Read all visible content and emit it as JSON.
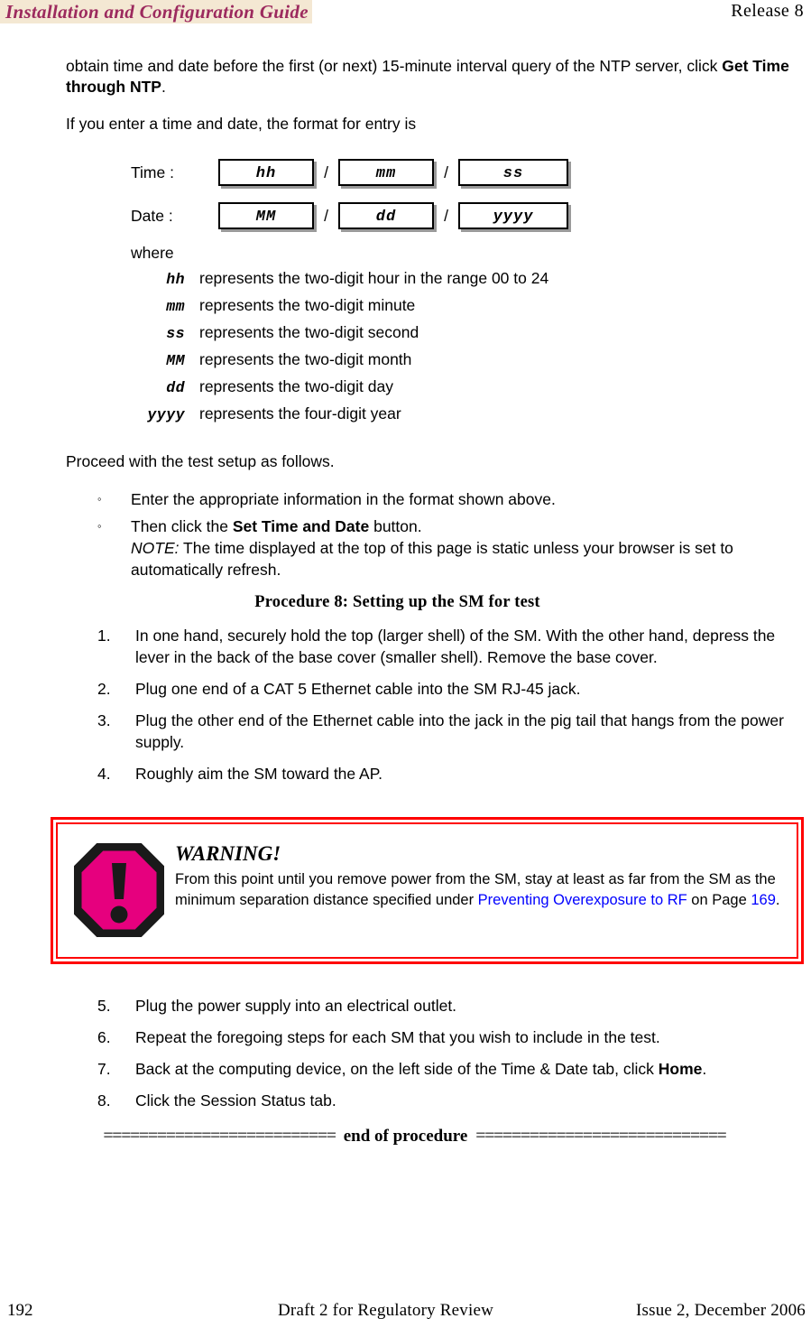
{
  "header": {
    "title": "Installation and Configuration Guide",
    "release": "Release 8",
    "highlight_color": "#f4e8d3",
    "title_color": "#9c2a5e"
  },
  "intro": {
    "para1_before": "obtain time and date before the first (or next) 15-minute interval query of the NTP server, click ",
    "para1_bold": "Get Time through NTP",
    "para1_after": ".",
    "para2": "If you enter a time and date, the format for entry is"
  },
  "entry_form": {
    "time_label": "Time :",
    "date_label": "Date :",
    "separator": "/",
    "time_fields": [
      "hh",
      "mm",
      "ss"
    ],
    "date_fields": [
      "MM",
      "dd",
      "yyyy"
    ]
  },
  "where": {
    "label": "where",
    "definitions": [
      {
        "term": "hh",
        "desc": "represents the two-digit hour in the range 00 to 24"
      },
      {
        "term": "mm",
        "desc": "represents the two-digit minute"
      },
      {
        "term": "ss",
        "desc": "represents the two-digit second"
      },
      {
        "term": "MM",
        "desc": "represents the two-digit month"
      },
      {
        "term": "dd",
        "desc": "represents the two-digit day"
      },
      {
        "term": "yyyy",
        "desc": "represents the four-digit year"
      }
    ]
  },
  "proceed": {
    "lead_in": "Proceed with the test setup as follows.",
    "bullet_mark": "◦",
    "bullets": {
      "b1": "Enter the appropriate information in the format shown above.",
      "b2_before": "Then click the ",
      "b2_bold": "Set Time and Date",
      "b2_after": " button.",
      "b2_note_label": "NOTE:",
      "b2_note_text": " The time displayed at the top of this page is static unless your browser is set to automatically refresh."
    }
  },
  "procedure": {
    "caption": "Procedure 8: Setting up the SM for test",
    "steps_first": [
      {
        "num": "1.",
        "text": "In one hand, securely hold the top (larger shell) of the SM. With the other hand, depress the lever in the back of the base cover (smaller shell). Remove the base cover."
      },
      {
        "num": "2.",
        "text": "Plug one end of a CAT 5 Ethernet cable into the SM RJ-45 jack."
      },
      {
        "num": "3.",
        "text": "Plug the other end of the Ethernet cable into the jack in the pig tail that hangs from the power supply."
      },
      {
        "num": "4.",
        "text": "Roughly aim the SM toward the AP."
      }
    ],
    "step5": {
      "num": "5.",
      "text": "Plug the power supply into an electrical outlet."
    },
    "step6": {
      "num": "6.",
      "text": "Repeat the foregoing steps for each SM that you wish to include in the test."
    },
    "step7": {
      "num": "7.",
      "text_before": "Back at the computing device, on the left side of the Time & Date tab, click ",
      "text_bold": "Home",
      "text_after": "."
    },
    "step8": {
      "num": "8.",
      "text": "Click the Session Status tab."
    }
  },
  "warning": {
    "title": "WARNING!",
    "text_before": "From this point until you remove power from the SM, stay at least as far from the SM as the minimum separation distance specified under ",
    "xref_title": "Preventing Overexposure to RF",
    "text_middle": "  on Page ",
    "xref_page": "169",
    "text_after": ".",
    "border_color": "#ff0000",
    "icon_fill": "#e6007e",
    "icon_stroke": "#1a1a1a",
    "link_color": "#0000ff"
  },
  "end_of_procedure": {
    "label": "end of procedure",
    "rule_left": "==========================",
    "rule_right": "============================"
  },
  "footer": {
    "page_number": "192",
    "center_text": "Draft 2 for Regulatory Review",
    "right_text": "Issue 2, December 2006"
  }
}
